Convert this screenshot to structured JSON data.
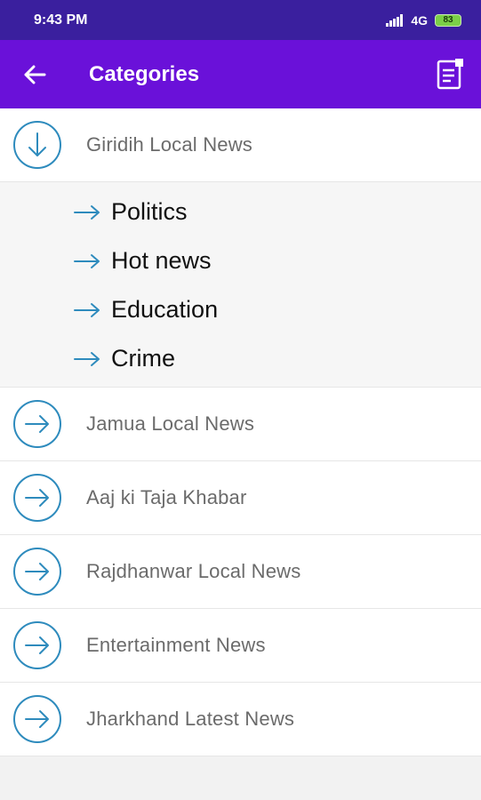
{
  "status": {
    "time": "9:43 PM",
    "network": "4G",
    "battery": "83"
  },
  "header": {
    "title": "Categories"
  },
  "colors": {
    "status_bar": "#3a1f9e",
    "app_bar": "#6a11d9",
    "icon_accent": "#2e8bbd"
  },
  "categories": [
    {
      "label": "Giridih Local News",
      "expanded": true,
      "subcategories": [
        "Politics",
        "Hot news",
        "Education",
        "Crime"
      ]
    },
    {
      "label": "Jamua Local News"
    },
    {
      "label": "Aaj ki Taja Khabar"
    },
    {
      "label": "Rajdhanwar Local News"
    },
    {
      "label": "Entertainment News"
    },
    {
      "label": "Jharkhand Latest News"
    }
  ]
}
